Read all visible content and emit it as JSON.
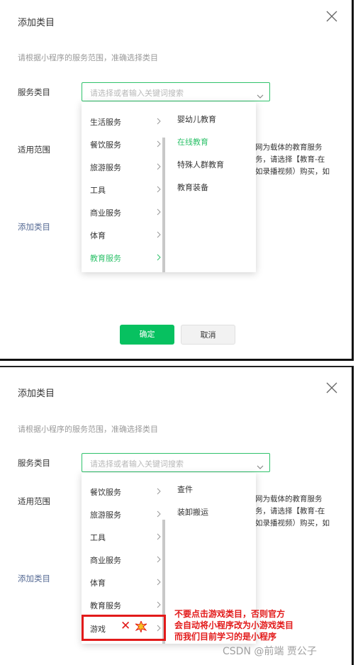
{
  "dialog1": {
    "title": "添加类目",
    "description": "请根据小程序的服务范围，准确选择类目",
    "service_label": "服务类目",
    "scope_label": "适用范围",
    "add_category": "添加类目",
    "search_placeholder": "请选择或者输入关键词搜索",
    "behind_text": [
      "网为载体的教育服务",
      "务，请选择【教育-在",
      "如录播视频）购买，如"
    ],
    "categories": [
      {
        "label": "生活服务"
      },
      {
        "label": "餐饮服务"
      },
      {
        "label": "旅游服务"
      },
      {
        "label": "工具"
      },
      {
        "label": "商业服务"
      },
      {
        "label": "体育"
      },
      {
        "label": "教育服务",
        "active": true
      }
    ],
    "subcategories": [
      {
        "label": "婴幼儿教育"
      },
      {
        "label": "在线教育",
        "active": true
      },
      {
        "label": "特殊人群教育"
      },
      {
        "label": "教育装备"
      }
    ],
    "confirm": "确定",
    "cancel": "取消"
  },
  "dialog2": {
    "title": "添加类目",
    "description": "请根据小程序的服务范围，准确选择类目",
    "service_label": "服务类目",
    "scope_label": "适用范围",
    "add_category": "添加类目",
    "search_placeholder": "请选择或者输入关键词搜索",
    "behind_text": [
      "网为载体的教育服务",
      "务，请选择【教育-在",
      "如录播视频）购买，如"
    ],
    "categories": [
      {
        "label": "餐饮服务"
      },
      {
        "label": "旅游服务"
      },
      {
        "label": "工具"
      },
      {
        "label": "商业服务"
      },
      {
        "label": "体育"
      },
      {
        "label": "教育服务"
      },
      {
        "label": "游戏"
      }
    ],
    "subcategories": [
      {
        "label": "查件"
      },
      {
        "label": "装卸搬运"
      }
    ]
  },
  "annotation": {
    "lines": [
      "不要点击游戏类目，否则官方",
      "会自动将小程序改为小游戏类目",
      "而我们目前学习的是小程序"
    ],
    "cross_icon": "✕",
    "colors": {
      "red": "#e21a1a",
      "green": "#07c160",
      "link": "#576b95"
    }
  },
  "watermark": "CSDN @前端 贾公子"
}
